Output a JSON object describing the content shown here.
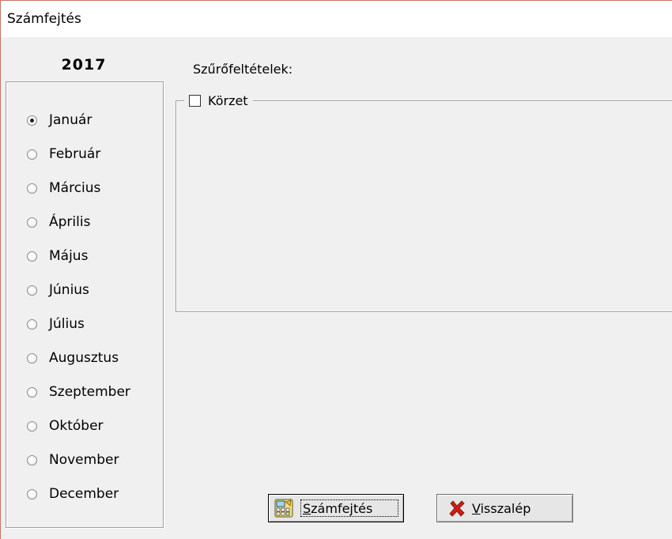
{
  "window": {
    "title": "Számfejtés"
  },
  "year": "2017",
  "months": {
    "selected": "Január",
    "items": [
      {
        "label": "Január",
        "checked": true
      },
      {
        "label": "Február",
        "checked": false
      },
      {
        "label": "Március",
        "checked": false
      },
      {
        "label": "Április",
        "checked": false
      },
      {
        "label": "Május",
        "checked": false
      },
      {
        "label": "Június",
        "checked": false
      },
      {
        "label": "Július",
        "checked": false
      },
      {
        "label": "Augusztus",
        "checked": false
      },
      {
        "label": "Szeptember",
        "checked": false
      },
      {
        "label": "Október",
        "checked": false
      },
      {
        "label": "November",
        "checked": false
      },
      {
        "label": "December",
        "checked": false
      }
    ]
  },
  "filters": {
    "label": "Szűrőfeltételek:",
    "korzet": {
      "label": "Körzet",
      "checked": false
    }
  },
  "buttons": {
    "calculate": {
      "accel": "S",
      "rest": "zámfejtés",
      "icon": "calculator-icon"
    },
    "back": {
      "accel": "V",
      "rest": "isszalép",
      "icon": "red-x-icon"
    }
  },
  "colors": {
    "window_border": "#c8746a",
    "background": "#f0f0f0",
    "back_icon": "#cc1f10"
  }
}
